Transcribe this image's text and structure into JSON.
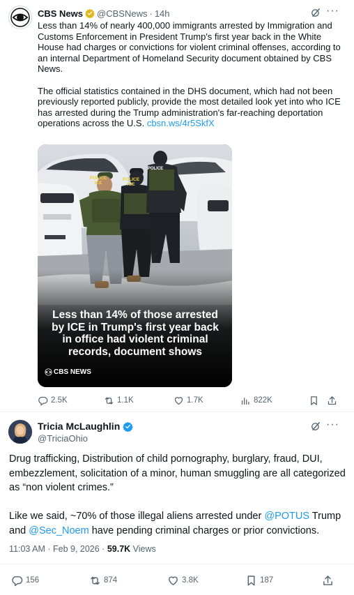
{
  "quoted_tweet": {
    "author_name": "CBS News",
    "handle": "@CBSNews",
    "separator": "·",
    "time": "14h",
    "paragraph_1": "Less than 14% of nearly 400,000 immigrants arrested by Immigration and Customs Enforcement in President Trump's first year back in the White House had charges or convictions for violent criminal offenses, according to an internal Department of Homeland Security document obtained by CBS News.",
    "paragraph_2": "The official statistics contained in the DHS document, which had not been previously reported publicly, provide the most detailed look yet into who ICE has arrested during the Trump administration's far-reaching deportation operations across the U.S.",
    "link": "cbsn.ws/4r5SkfX",
    "media": {
      "vest_label_1": "POLICE",
      "vest_label_2": "ICE",
      "vest_label_3": "POLICE",
      "caption": "Less than 14% of those arrested by ICE in Trump's first year back in office had violent criminal records, document shows",
      "brand": "CBS NEWS"
    },
    "actions": {
      "replies": "2.5K",
      "reposts": "1.1K",
      "likes": "1.7K",
      "views": "822K"
    }
  },
  "main_tweet": {
    "author_name": "Tricia McLaughlin",
    "handle": "@TriciaOhio",
    "paragraph_1": "Drug trafficking, Distribution of child pornography, burglary, fraud, DUI, embezzlement, solicitation of a minor, human smuggling are all categorized as “non violent crimes.”",
    "paragraph_2_start": "Like we said, ~70% of those illegal aliens arrested under ",
    "mention_1": "@POTUS",
    "paragraph_2_mid": " Trump and ",
    "mention_2": "@Sec_Noem",
    "paragraph_2_end": " have pending criminal charges or prior convictions.",
    "timestamp": "11:03 AM · Feb 9, 2026 · ",
    "view_count": "59.7K",
    "views_label": " Views",
    "actions": {
      "replies": "156",
      "reposts": "874",
      "likes": "3.8K",
      "bookmarks": "187"
    }
  },
  "colors": {
    "text_primary": "#0f1419",
    "text_secondary": "#536471",
    "link": "#1d9bf0",
    "verified_gold": "#e2b719",
    "verified_blue": "#1d9bf0"
  },
  "icons": [
    "cbs-eye-logo-icon",
    "verified-gold-badge-icon",
    "verified-blue-badge-icon",
    "grok-icon",
    "more-icon",
    "reply-icon",
    "repost-icon",
    "like-icon",
    "views-icon",
    "bookmark-icon",
    "share-icon"
  ]
}
